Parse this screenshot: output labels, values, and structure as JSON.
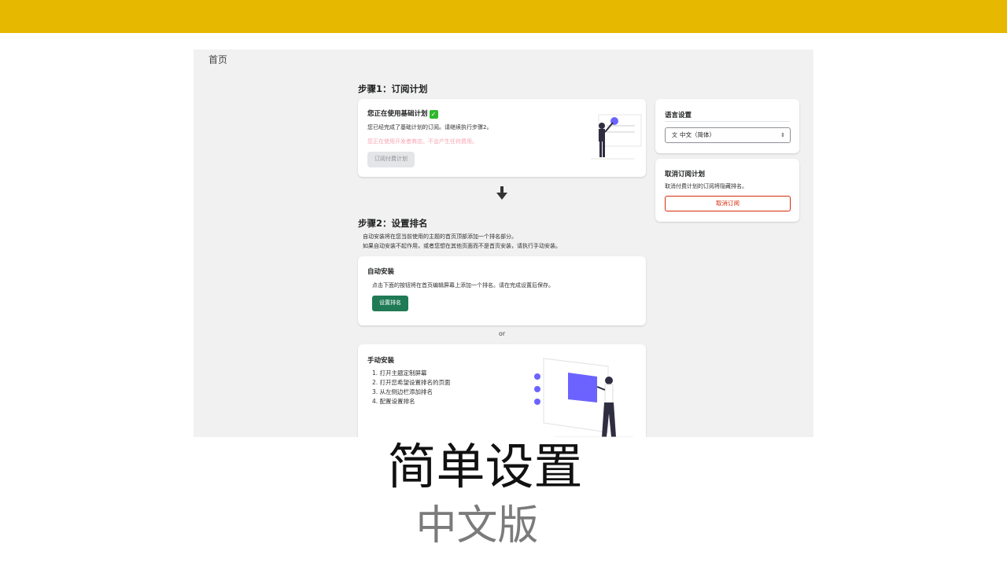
{
  "page": {
    "title": "首页"
  },
  "step1": {
    "title": "步骤1：订阅计划",
    "card": {
      "heading": "您正在使用基础计划",
      "desc": "您已经完成了基础计划的订阅。请继续执行步骤2。",
      "notice": "您正在使用开发者商店。不会产生任何费用。",
      "button": "订阅付费计划"
    }
  },
  "step2": {
    "title": "步骤2：设置排名",
    "desc1": "自动安装将在您当前使用的主题的首页顶部添加一个排名部分。",
    "desc2": "如果自动安装不起作用，或者您想在其他页面而不是首页安装，请执行手动安装。",
    "auto": {
      "heading": "自动安装",
      "desc": "点击下面的按钮将在首页编辑屏幕上添加一个排名。请在完成设置后保存。",
      "button": "设置排名"
    },
    "or": "or",
    "manual": {
      "heading": "手动安装",
      "steps": [
        "1. 打开主题定制屏幕",
        "2. 打开您希望设置排名的页面",
        "3. 从左侧边栏添加排名",
        "4. 配置设置排名"
      ]
    }
  },
  "language": {
    "heading": "语言设置",
    "selected": "中文（简体）",
    "icon": "translate-icon"
  },
  "cancel": {
    "heading": "取消订阅计划",
    "desc": "取消付费计划的订阅将隐藏排名。",
    "button": "取消订阅"
  },
  "caption": {
    "line1": "简单设置",
    "line2": "中文版"
  },
  "colors": {
    "topbar": "#e6b800",
    "primary": "#1f7a55",
    "danger": "#d72c0d",
    "illustration_accent": "#6c63ff"
  }
}
